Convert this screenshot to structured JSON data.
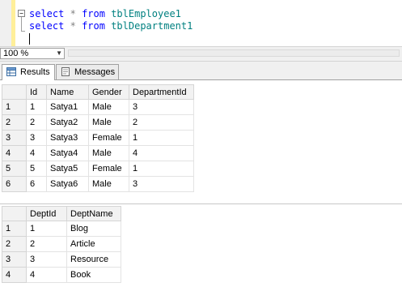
{
  "editor": {
    "line1": {
      "kw_select": "select",
      "star": "*",
      "kw_from": "from",
      "table": "tblEmployee1"
    },
    "line2": {
      "kw_select": "select",
      "star": "*",
      "kw_from": "from",
      "table": "tblDepartment1"
    }
  },
  "zoom": {
    "value": "100 %"
  },
  "tabs": [
    {
      "label": "Results",
      "icon": "grid-icon",
      "active": true
    },
    {
      "label": "Messages",
      "icon": "messages-icon",
      "active": false
    }
  ],
  "employees": {
    "columns": [
      "Id",
      "Name",
      "Gender",
      "DepartmentId"
    ],
    "rows": [
      {
        "n": "1",
        "cells": [
          "1",
          "Satya1",
          "Male",
          "3"
        ]
      },
      {
        "n": "2",
        "cells": [
          "2",
          "Satya2",
          "Male",
          "2"
        ]
      },
      {
        "n": "3",
        "cells": [
          "3",
          "Satya3",
          "Female",
          "1"
        ]
      },
      {
        "n": "4",
        "cells": [
          "4",
          "Satya4",
          "Male",
          "4"
        ]
      },
      {
        "n": "5",
        "cells": [
          "5",
          "Satya5",
          "Female",
          "1"
        ]
      },
      {
        "n": "6",
        "cells": [
          "6",
          "Satya6",
          "Male",
          "3"
        ]
      }
    ]
  },
  "departments": {
    "columns": [
      "DeptId",
      "DeptName"
    ],
    "rows": [
      {
        "n": "1",
        "cells": [
          "1",
          "Blog"
        ]
      },
      {
        "n": "2",
        "cells": [
          "2",
          "Article"
        ]
      },
      {
        "n": "3",
        "cells": [
          "3",
          "Resource"
        ]
      },
      {
        "n": "4",
        "cells": [
          "4",
          "Book"
        ]
      }
    ]
  }
}
